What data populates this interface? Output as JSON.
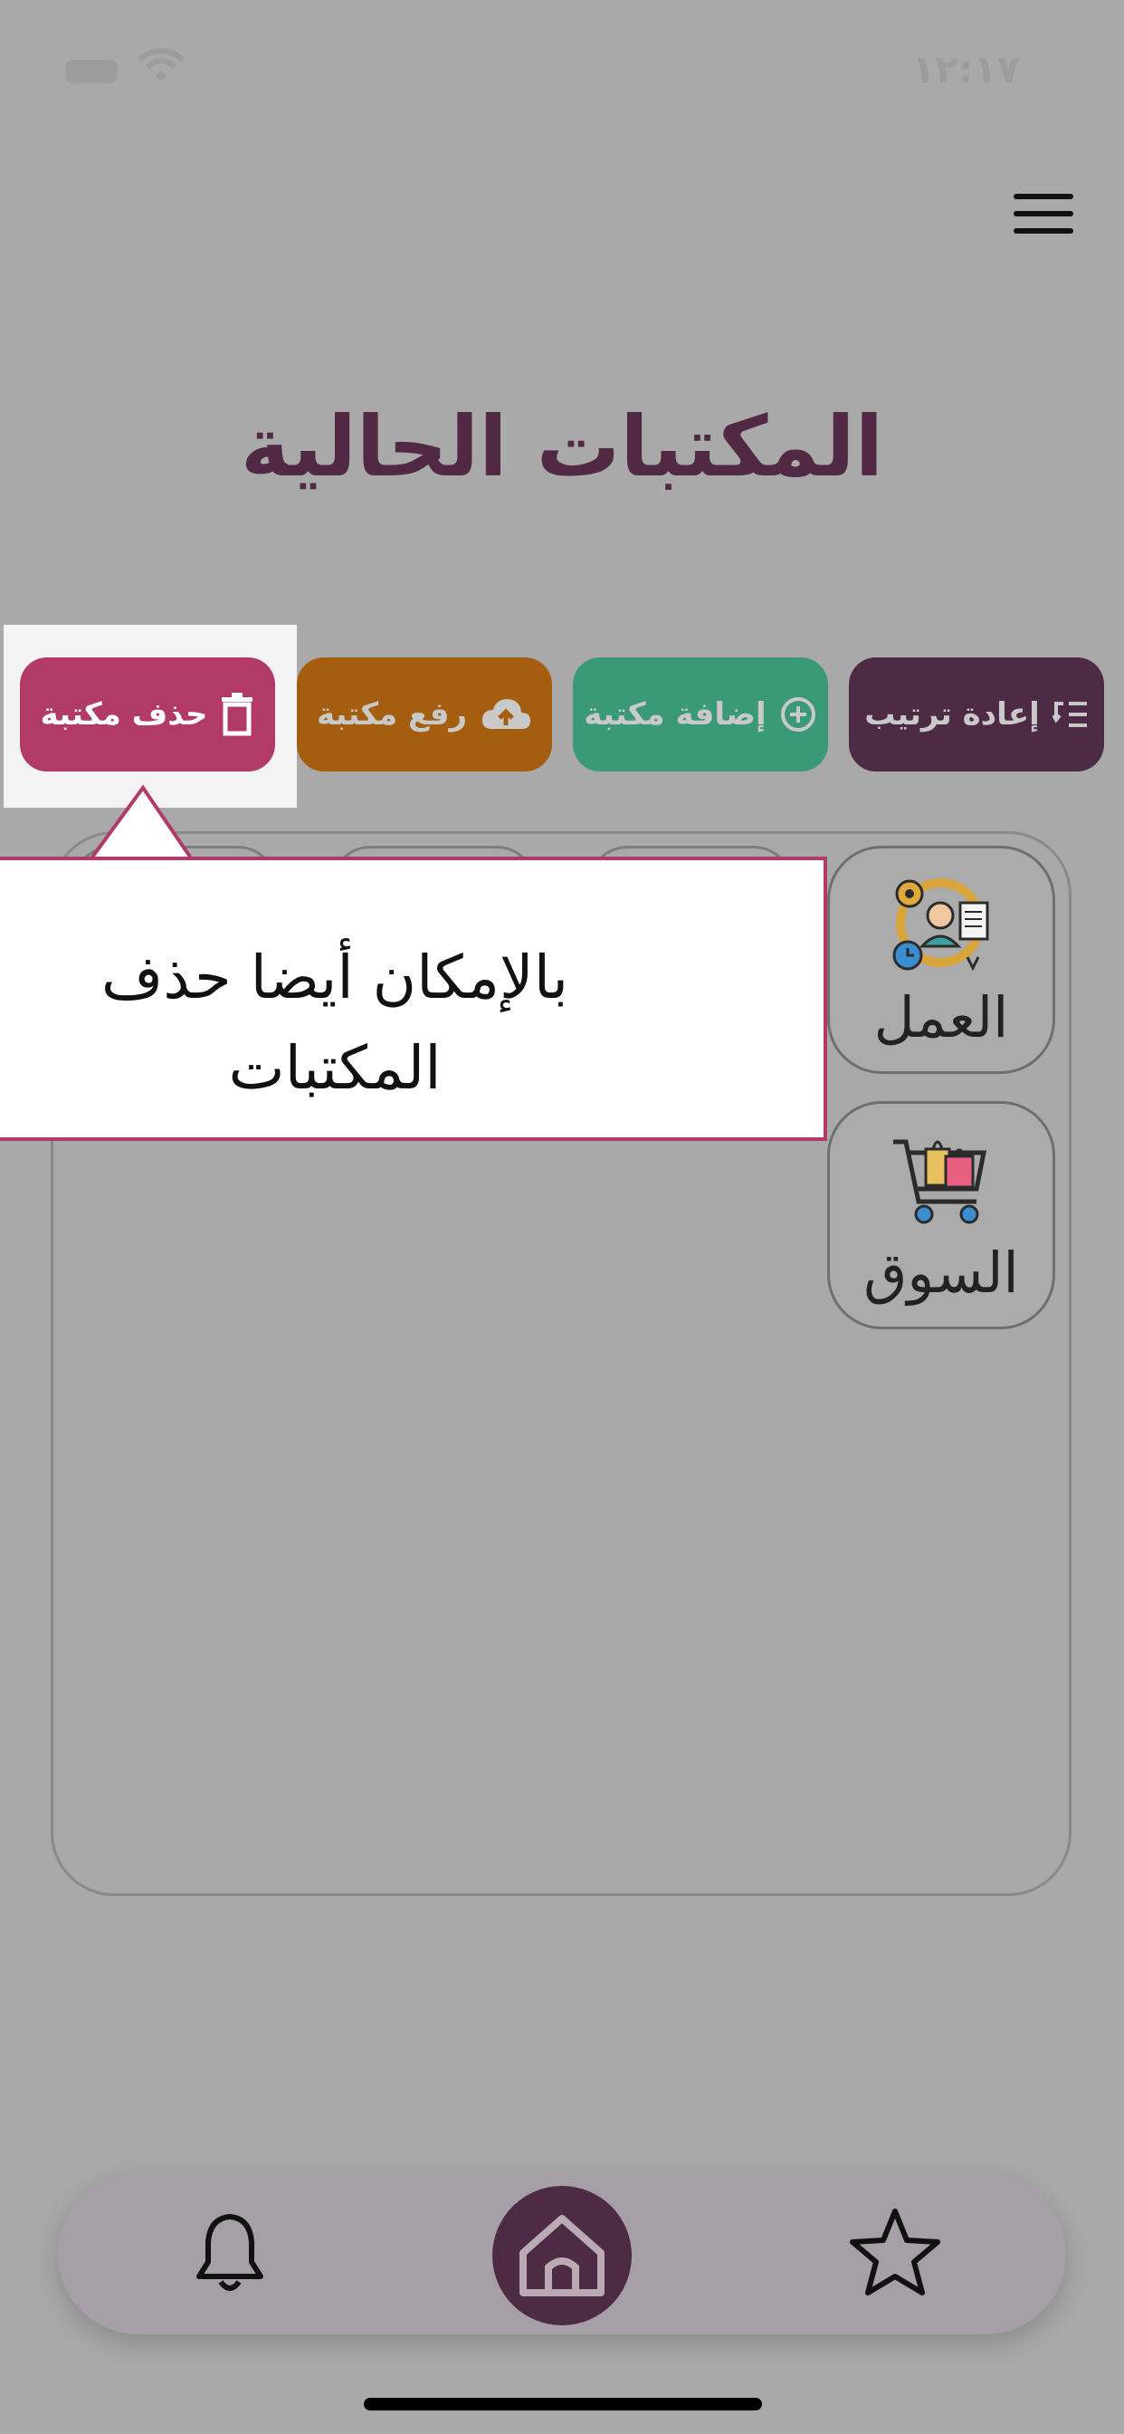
{
  "status_bar": {
    "time": "١٢:١٧"
  },
  "page": {
    "title": "المكتبات الحالية"
  },
  "actions": {
    "reorder_label": "إعادة ترتيب",
    "add_label": "إضافة مكتبة",
    "upload_label": "رفع مكتبة",
    "delete_label": "حذف مكتبة"
  },
  "libraries": [
    {
      "label": "العمل",
      "icon": "work-icon"
    },
    {
      "label": "السوق",
      "icon": "shopping-cart-icon"
    }
  ],
  "tooltip": {
    "text": "بالإمكان أيضا حذف المكتبات"
  },
  "nav": {
    "items": [
      "bell-icon",
      "home-icon",
      "star-icon"
    ]
  },
  "colors": {
    "primary": "#4d2b44",
    "add": "#3a9a78",
    "upload": "#a55e10",
    "delete": "#b13a69",
    "overlay": "#a9a9a9"
  }
}
